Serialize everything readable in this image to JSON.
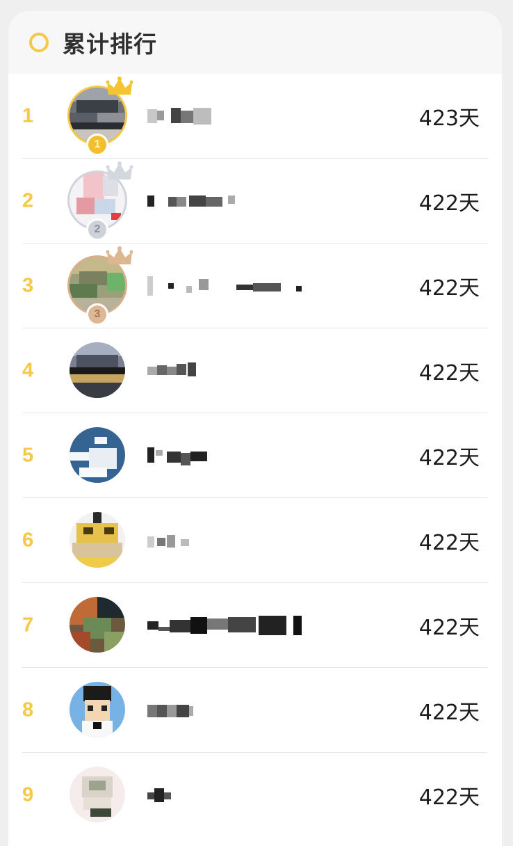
{
  "header": {
    "title": "累计排行",
    "icon": "ring-icon",
    "accent_color": "#f5c945"
  },
  "rows": [
    {
      "rank": "1",
      "days": "423天",
      "medal": "1",
      "tier": "gold"
    },
    {
      "rank": "2",
      "days": "422天",
      "medal": "2",
      "tier": "silver"
    },
    {
      "rank": "3",
      "days": "422天",
      "medal": "3",
      "tier": "bronze"
    },
    {
      "rank": "4",
      "days": "422天"
    },
    {
      "rank": "5",
      "days": "422天"
    },
    {
      "rank": "6",
      "days": "422天"
    },
    {
      "rank": "7",
      "days": "422天"
    },
    {
      "rank": "8",
      "days": "422天"
    },
    {
      "rank": "9",
      "days": "422天"
    }
  ]
}
